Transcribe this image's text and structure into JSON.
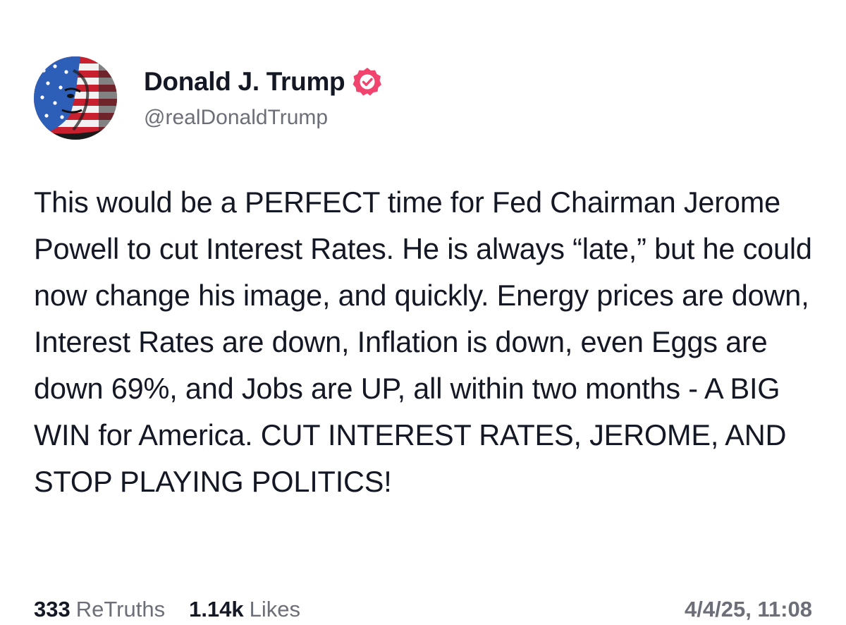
{
  "author": {
    "display_name": "Donald J. Trump",
    "handle": "@realDonaldTrump",
    "verified_icon": "verified-badge-icon",
    "verified_color": "#f0436e"
  },
  "post": {
    "text": "This would be a PERFECT time for Fed Chairman Jerome Powell to cut Interest Rates. He is always “late,” but he could now change his image, and quickly. Energy prices are down, Interest Rates are down, Inflation is down, even Eggs are down 69%, and Jobs are UP, all within two months - A BIG WIN for America. CUT INTEREST RATES, JEROME, AND STOP PLAYING POLITICS!"
  },
  "footer": {
    "retruths_count": "333",
    "retruths_label": "ReTruths",
    "likes_count": "1.14k",
    "likes_label": "Likes",
    "timestamp": "4/4/25, 11:08"
  },
  "colors": {
    "text_primary": "#141724",
    "text_secondary": "#6c6e78",
    "background": "#ffffff"
  }
}
